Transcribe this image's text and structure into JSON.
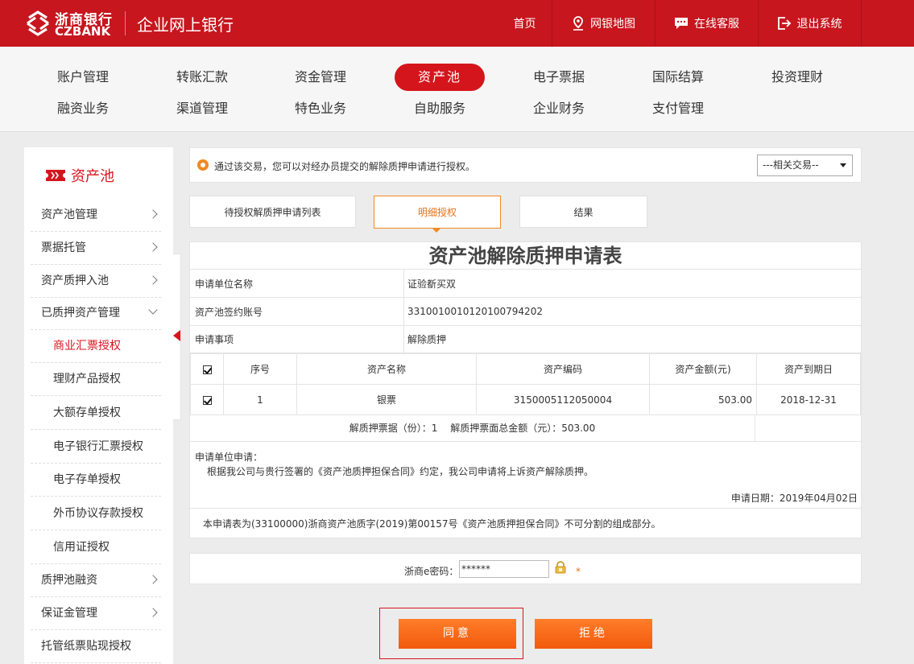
{
  "header": {
    "logo_cn": "浙商银行",
    "logo_en": "CZBANK",
    "site_title": "企业网上银行",
    "nav": [
      {
        "label": "首页",
        "icon": ""
      },
      {
        "label": "网银地图",
        "icon": "map-pin-icon"
      },
      {
        "label": "在线客服",
        "icon": "chat-icon"
      },
      {
        "label": "退出系统",
        "icon": "logout-icon"
      }
    ]
  },
  "main_nav": {
    "row1": [
      "账户管理",
      "转账汇款",
      "资金管理",
      "资产池",
      "电子票据",
      "国际结算",
      "投资理财"
    ],
    "row2": [
      "融资业务",
      "渠道管理",
      "特色业务",
      "自助服务",
      "企业财务",
      "支付管理"
    ],
    "active": "资产池"
  },
  "sidebar": {
    "title": "资产池",
    "items": [
      {
        "label": "资产池管理",
        "arrow": "right"
      },
      {
        "label": "票据托管",
        "arrow": "right"
      },
      {
        "label": "资产质押入池",
        "arrow": "right"
      },
      {
        "label": "已质押资产管理",
        "arrow": "down"
      },
      {
        "label": "商业汇票授权",
        "sub": true,
        "active": true
      },
      {
        "label": "理财产品授权",
        "sub": true
      },
      {
        "label": "大额存单授权",
        "sub": true
      },
      {
        "label": "电子银行汇票授权",
        "sub": true
      },
      {
        "label": "电子存单授权",
        "sub": true
      },
      {
        "label": "外币协议存款授权",
        "sub": true
      },
      {
        "label": "信用证授权",
        "sub": true
      },
      {
        "label": "质押池融资",
        "arrow": "right"
      },
      {
        "label": "保证金管理",
        "arrow": "right"
      },
      {
        "label": "托管纸票贴现授权",
        "arrow": ""
      }
    ]
  },
  "notice": {
    "text": "通过该交易，您可以对经办员提交的解除质押申请进行授权。",
    "related_select": "---相关交易--"
  },
  "tabs": [
    "待授权解质押申请列表",
    "明细授权",
    "结果"
  ],
  "form": {
    "title": "资产池解除质押申请表",
    "fields": [
      {
        "label": "申请单位名称",
        "value": "证验斱买双"
      },
      {
        "label": "资产池签约账号",
        "value": "3310010010120100794202"
      },
      {
        "label": "申请事项",
        "value": "解除质押"
      }
    ],
    "columns": [
      "序号",
      "资产名称",
      "资产编码",
      "资产金额(元)",
      "资产到期日"
    ],
    "rows": [
      {
        "no": "1",
        "name": "银票",
        "code": "3150005112050004",
        "amount": "503.00",
        "due": "2018-12-31"
      }
    ],
    "summary": "解质押票据（份）：1　 解质押票面总金额（元）：503.00",
    "apply_label": "申请单位申请：",
    "apply_text": "根据我公司与贵行签署的《资产池质押担保合同》约定，我公司申请将上诉资产解除质押。",
    "apply_date": "申请日期：2019年04月02日",
    "footnote": "本申请表为(33100000)浙商资产池质字(2019)第00157号《资产池质押担保合同》不可分割的组成部分。"
  },
  "password": {
    "label": "浙商e密码：",
    "value": "******",
    "required_mark": "*"
  },
  "actions": {
    "agree": "同意",
    "reject": "拒绝"
  },
  "colors": {
    "brand_red": "#c7161e",
    "accent_orange": "#f25a0b"
  }
}
